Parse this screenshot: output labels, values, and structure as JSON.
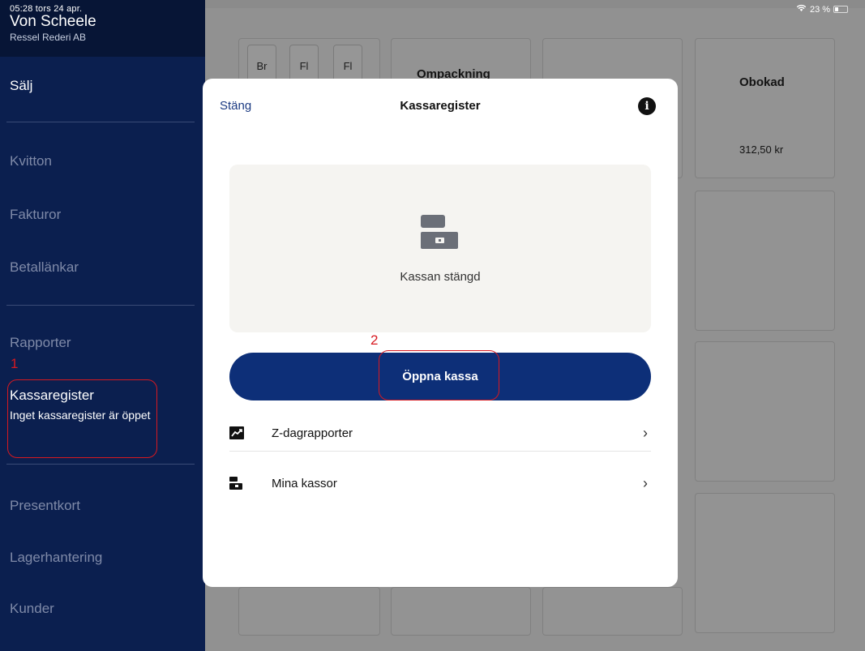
{
  "status_bar": {
    "time": "05:28",
    "date": "tors 24 apr.",
    "battery": "23 %"
  },
  "sidebar": {
    "company": "Von Scheele",
    "subcompany": "Ressel Rederi AB",
    "items": [
      {
        "label": "Sälj"
      },
      {
        "label": "Kvitton"
      },
      {
        "label": "Fakturor"
      },
      {
        "label": "Betallänkar"
      },
      {
        "label": "Rapporter"
      },
      {
        "label": "Kassaregister",
        "sub": "Inget kassaregister är öppet"
      },
      {
        "label": "Presentkort"
      },
      {
        "label": "Lagerhantering"
      },
      {
        "label": "Kunder"
      }
    ]
  },
  "background": {
    "buttons": [
      "Br",
      "Fl",
      "Fl"
    ],
    "tiles": [
      {
        "label": "Ompackning"
      },
      {
        "label": "Obokad",
        "price": "312,50 kr"
      }
    ]
  },
  "modal": {
    "close_label": "Stäng",
    "title": "Kassaregister",
    "info_icon": "i",
    "status_text": "Kassan stängd",
    "primary_button": "Öppna kassa",
    "rows": [
      {
        "label": "Z-dagrapporter",
        "icon": "trend-chart-icon"
      },
      {
        "label": "Mina kassor",
        "icon": "cash-register-icon"
      }
    ]
  },
  "annotations": [
    "1",
    "2"
  ],
  "colors": {
    "sidebar": "#0b1f4f",
    "primary": "#0d2f78",
    "annotation": "#d71920"
  }
}
